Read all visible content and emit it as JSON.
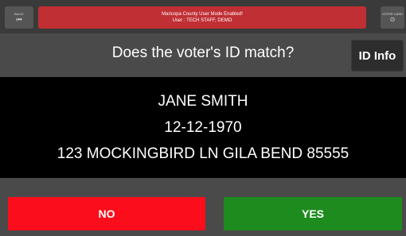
{
  "topbar": {
    "back_label": "BACK",
    "back_icon": "⏮",
    "banner_line1": "Maricopa County User Mode Enabled!",
    "banner_line2": "User : TECH STAFF, DEMO",
    "voter_card_label": "VOTER CARD",
    "voter_card_icon": "⊙"
  },
  "question": {
    "text": "Does the voter's ID match?",
    "id_info_label": "ID Info"
  },
  "voter": {
    "name": "JANE SMITH",
    "dob": "12-12-1970",
    "address": "123 MOCKINGBIRD LN GILA BEND 85555"
  },
  "answers": {
    "no_label": "NO",
    "yes_label": "YES"
  },
  "colors": {
    "banner": "#c02f34",
    "no": "#fc0d1b",
    "yes": "#1e8b1f",
    "background": "#4a4a4a",
    "panel": "#000000"
  }
}
